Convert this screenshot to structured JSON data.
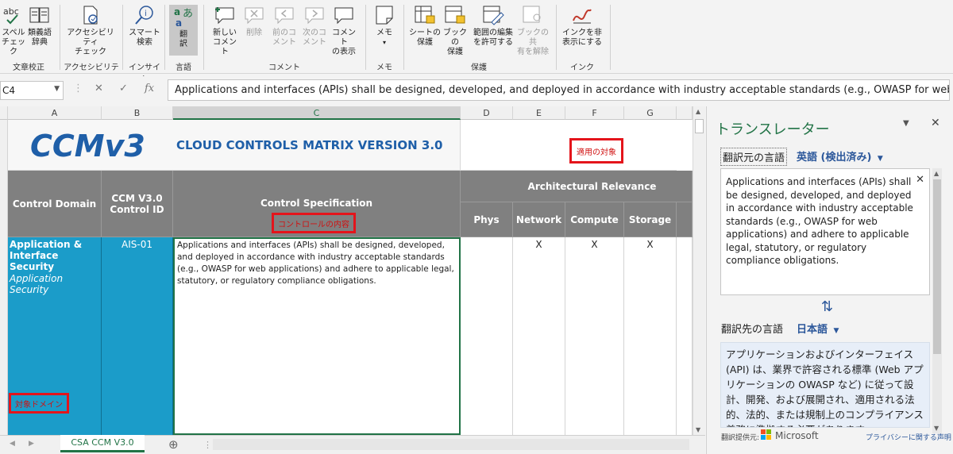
{
  "ribbon": {
    "groups": [
      {
        "label": "文章校正",
        "buttons": [
          {
            "l1": "スペル",
            "l2": "チェック",
            "icon": "abc-check-icon"
          },
          {
            "l1": "類義語",
            "l2": "辞典",
            "icon": "book-icon"
          }
        ]
      },
      {
        "label": "アクセシビリティ",
        "buttons": [
          {
            "l1": "アクセシビリティ",
            "l2": "チェック",
            "icon": "accessibility-icon"
          }
        ]
      },
      {
        "label": "インサイト",
        "buttons": [
          {
            "l1": "スマート",
            "l2": "検索",
            "icon": "smart-search-icon"
          }
        ]
      },
      {
        "label": "言語",
        "buttons": [
          {
            "l1": "翻",
            "l2": "訳",
            "icon": "translate-icon"
          }
        ]
      },
      {
        "label": "コメント",
        "buttons": [
          {
            "l1": "新しい",
            "l2": "コメント",
            "icon": "new-comment-icon"
          },
          {
            "l1": "削除",
            "l2": "",
            "icon": "delete-comment-icon"
          },
          {
            "l1": "前のコ",
            "l2": "メント",
            "icon": "prev-comment-icon"
          },
          {
            "l1": "次のコ",
            "l2": "メント",
            "icon": "next-comment-icon"
          },
          {
            "l1": "コメント",
            "l2": "の表示",
            "icon": "show-comments-icon"
          }
        ]
      },
      {
        "label": "メモ",
        "buttons": [
          {
            "l1": "メモ",
            "l2": "▾",
            "icon": "note-icon"
          }
        ]
      },
      {
        "label": "保護",
        "buttons": [
          {
            "l1": "シートの",
            "l2": "保護",
            "icon": "protect-sheet-icon"
          },
          {
            "l1": "ブックの",
            "l2": "保護",
            "icon": "protect-book-icon"
          },
          {
            "l1": "範囲の編集",
            "l2": "を許可する",
            "icon": "allow-edit-range-icon"
          },
          {
            "l1": "ブックの共",
            "l2": "有を解除",
            "icon": "unshare-book-icon"
          }
        ]
      },
      {
        "label": "インク",
        "buttons": [
          {
            "l1": "インクを非",
            "l2": "表示にする",
            "icon": "hide-ink-icon"
          }
        ]
      }
    ]
  },
  "formula_bar": {
    "name_box": "C4",
    "content": "Applications and interfaces (APIs) shall be designed, developed, and deployed in accordance with industry acceptable standards (e.g., OWASP for web"
  },
  "grid": {
    "columns": [
      "A",
      "B",
      "C",
      "D",
      "E",
      "F",
      "G"
    ],
    "banner_title": "CLOUD CONTROLS MATRIX VERSION 3.0",
    "logo_text": "CCMv3",
    "annotation_applies": "適用の対象",
    "annotation_content": "コントロールの内容",
    "annotation_domain": "対象ドメイン",
    "headers": {
      "control_domain": "Control Domain",
      "control_id": "CCM V3.0\nControl ID",
      "control_spec": "Control Specification",
      "arch_relevance": "Architectural Relevance",
      "phys": "Phys",
      "network": "Network",
      "compute": "Compute",
      "storage": "Storage"
    },
    "row": {
      "domain_title": "Application & Interface Security",
      "domain_sub": "Application Security",
      "control_id": "AIS-01",
      "spec": "Applications and interfaces (APIs) shall be designed, developed, and deployed in accordance with industry acceptable standards (e.g., OWASP for web applications) and adhere to applicable legal, statutory, or regulatory compliance obligations.",
      "phys": "",
      "network": "X",
      "compute": "X",
      "storage": "X"
    }
  },
  "sheet_tab": "CSA CCM V3.0",
  "translator": {
    "title": "トランスレーター",
    "source_label": "翻訳元の言語",
    "source_lang": "英語 (検出済み)",
    "source_text": "Applications and interfaces (APIs) shall be designed, developed, and deployed in accordance with industry acceptable standards (e.g., OWASP for web applications) and adhere to applicable legal, statutory, or regulatory compliance obligations.",
    "target_label": "翻訳先の言語",
    "target_lang": "日本語",
    "target_text": "アプリケーションおよびインターフェイス (API) は、業界で許容される標準 (Web アプリケーションの OWASP など) に従って設計、開発、および展開され、適用される法的、法的、または規制上のコンプライアンス義務に準拠する必要があります。",
    "provider_label": "翻訳提供元:",
    "provider": "Microsoft",
    "privacy_link": "プライバシーに関する声明"
  },
  "colors": {
    "accent": "#217346",
    "domain_fill": "#1b9cc9",
    "header_gray": "#808080",
    "annotation_red": "#e4141b",
    "link_blue": "#2b579a"
  }
}
